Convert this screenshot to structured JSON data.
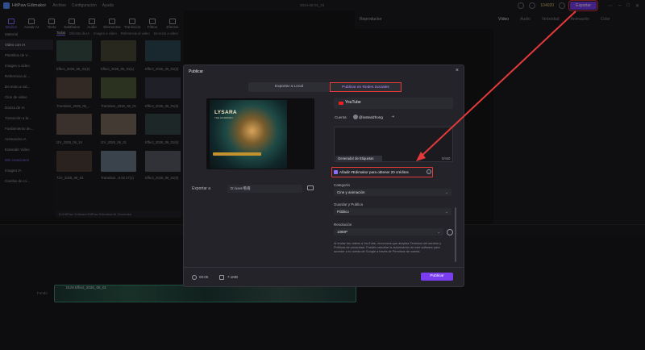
{
  "app": {
    "title": "HitPaw Edimakor",
    "menus": [
      "Archivo",
      "Configuración",
      "Ayuda"
    ],
    "project_name": "2024-06-01_01",
    "credits": "104020",
    "export_label": "Exportar"
  },
  "tooltabs": [
    "Medios",
    "Avatar AI",
    "Texto",
    "Subtítulos",
    "Audio",
    "Elementos",
    "Transición",
    "Filtros",
    "Efectos"
  ],
  "sidebar": [
    "Material",
    "Video con IA",
    "Plantillas de V...",
    "Imagen a video",
    "Referencia al ...",
    "De texto a vid...",
    "Clon de video",
    "Danza de IA",
    "Transición a le...",
    "Fusilamiento de...",
    "Animación IA",
    "Extender Video",
    "Mis creaciones",
    "Imagen IA",
    "Cambio de ro..."
  ],
  "media": {
    "subtabs": [
      "Todos",
      "Efectos de IA",
      "Imagen a video",
      "Referencia al video",
      "De texto a video",
      "Danza de IA",
      "Animación IA",
      "Transición a la IA",
      "Estilo"
    ],
    "captions": [
      "Effect_2026_06_01(2)",
      "Effect_2026_06_01(1)",
      "Effect_2026_06_01(3)",
      "Transition_2026_06_...",
      "Transition_2026_06_01",
      "Effect_2026_06_01(6)",
      "I2V_2026_06_24",
      "I2V_2026_06_01",
      "Effect_2026_06_01(6)",
      "T2V_2026_06_03",
      "Transition...9 02 27(1)",
      "Effect_2026_06_01(0)"
    ],
    "path": "D:/HitPaw Software/HitPaw Edimakor/AI Generator"
  },
  "player": {
    "label": "Reproductor"
  },
  "right_panel": {
    "tabs": [
      "Vídeo",
      "Audio",
      "Velocidad",
      "Animación",
      "Color"
    ]
  },
  "timeline": {
    "clip_label": "DUN Effect_2026_06_01",
    "track_label": "Fondo"
  },
  "dialog": {
    "title": "Publicar",
    "tab_local": "Exportar a Local",
    "tab_social": "Publicar en Redes Sociales",
    "preview_title": "LYSARA",
    "preview_sub": "THE GUARDIAN",
    "platform": "YouTube",
    "account_label": "Cuenta:",
    "account_name": "@lostealzhong",
    "tag_button": "Generador de Etiquetas",
    "char_count": "0/440",
    "watermark_label": "Añadir #Edimakor para obtener 20 créditos",
    "category_label": "Categoría",
    "category_value": "Cine y animación",
    "visibility_label": "Guardar y Publica",
    "visibility_value": "Público",
    "resolution_label": "Resolución",
    "resolution_value": "1080P",
    "terms": "Al enviar tus videos a YouTube, reconoces que aceptas Términos del servicio y Políticas de privacidad. Puedes cancelar la autorización de este software para acceder a tu cuenta de Google a través de Permisos de cuenta.",
    "export_to_label": "Exportar a",
    "export_path": "D:/user/看看",
    "duration": "00:05",
    "filesize": "7.1MB",
    "publish_label": "Publicar"
  }
}
